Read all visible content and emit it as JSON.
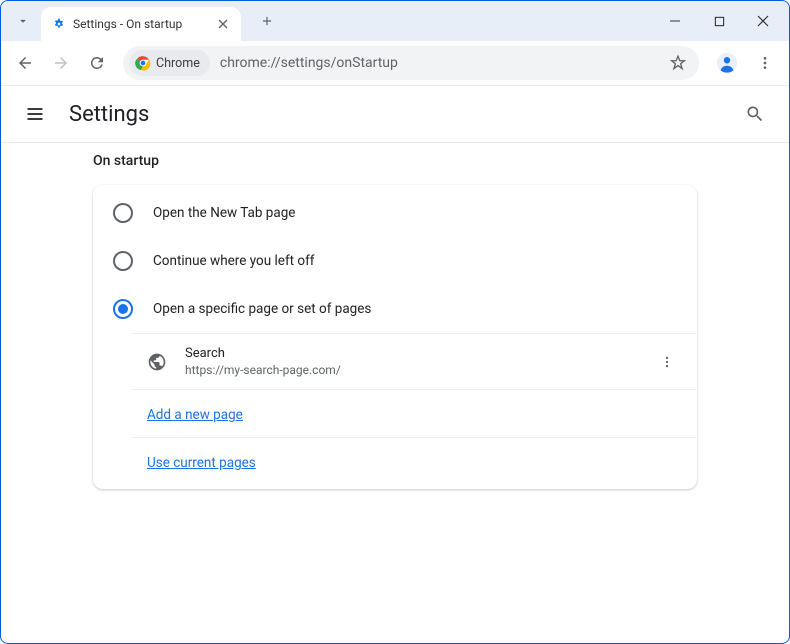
{
  "window": {
    "tab_title": "Settings - On startup"
  },
  "toolbar": {
    "chrome_chip": "Chrome",
    "url": "chrome://settings/onStartup"
  },
  "settings": {
    "title": "Settings",
    "section": "On startup",
    "options": [
      {
        "label": "Open the New Tab page",
        "selected": false
      },
      {
        "label": "Continue where you left off",
        "selected": false
      },
      {
        "label": "Open a specific page or set of pages",
        "selected": true
      }
    ],
    "pages": [
      {
        "title": "Search",
        "url": "https://my-search-page.com/"
      }
    ],
    "add_page_label": "Add a new page",
    "use_current_label": "Use current pages"
  }
}
